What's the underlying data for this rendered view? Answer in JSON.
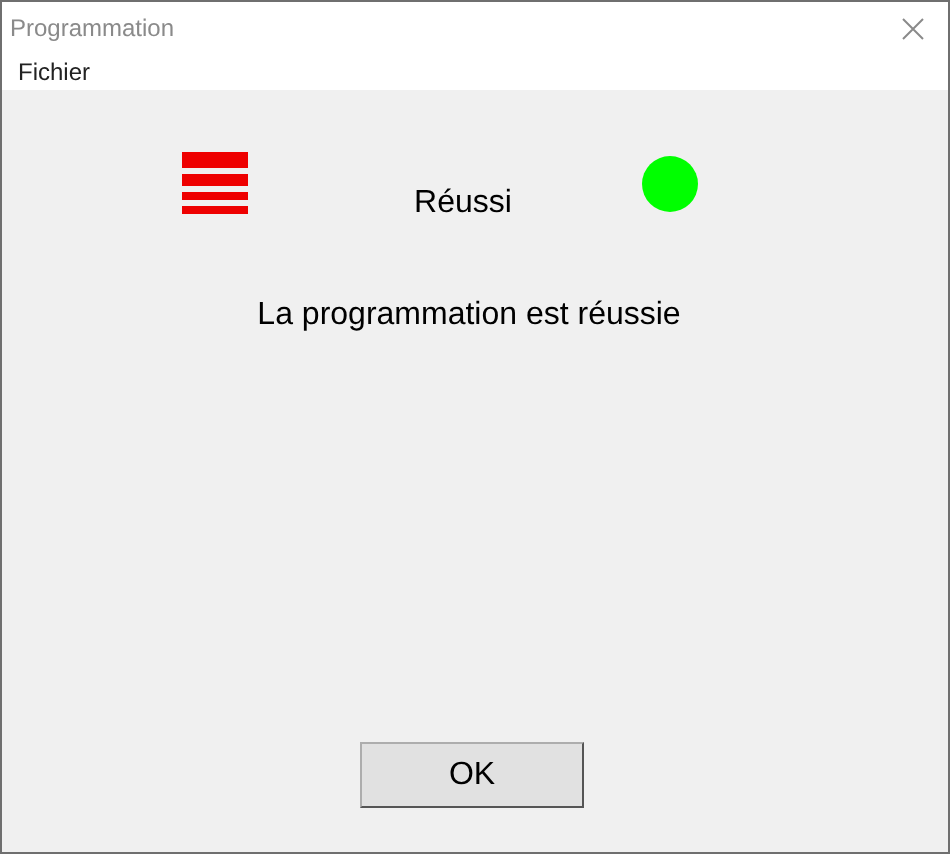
{
  "window": {
    "title": "Programmation"
  },
  "menu": [
    "Fichier"
  ],
  "status": {
    "label": "Réussi",
    "color": "#00ff00"
  },
  "message": "La programmation est réussie",
  "buttons": [
    "OK"
  ]
}
